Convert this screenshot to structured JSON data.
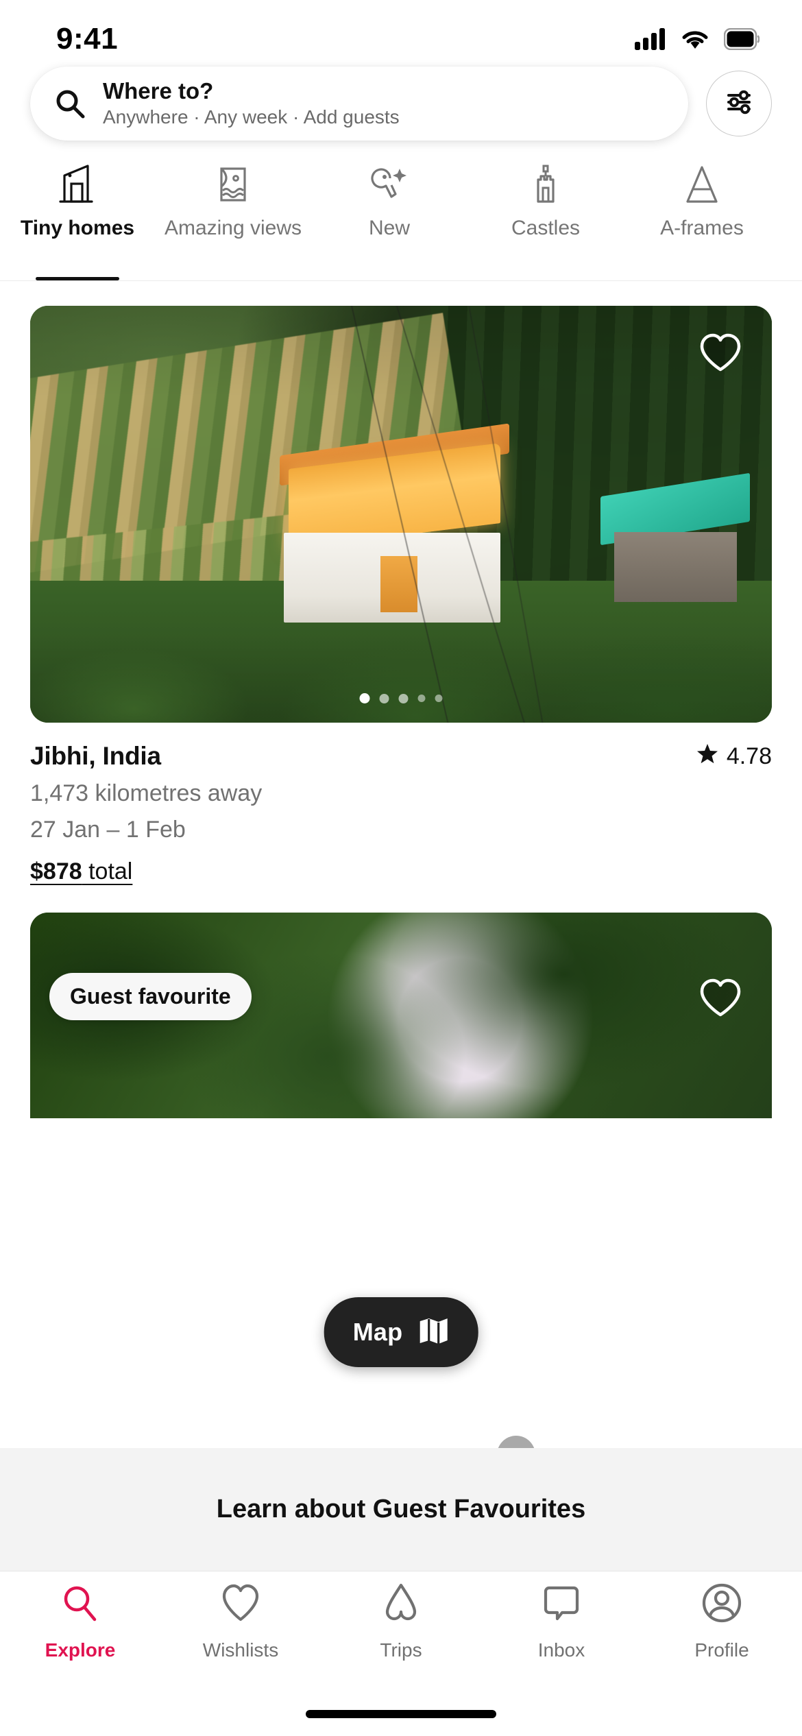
{
  "status_bar": {
    "time": "9:41",
    "icons": [
      "cellular-signal-icon",
      "wifi-icon",
      "battery-icon"
    ]
  },
  "search": {
    "icon": "search-icon",
    "title": "Where to?",
    "subtitle": "Anywhere · Any week · Add guests",
    "placeholder": "Where to?",
    "filter_icon": "filter-sliders-icon"
  },
  "categories": [
    {
      "label": "Tiny homes",
      "icon": "tiny-home-icon",
      "active": true
    },
    {
      "label": "Amazing views",
      "icon": "amazing-views-icon",
      "active": false
    },
    {
      "label": "New",
      "icon": "new-sparkle-icon",
      "active": false
    },
    {
      "label": "Castles",
      "icon": "castle-icon",
      "active": false
    },
    {
      "label": "A-frames",
      "icon": "a-frame-icon",
      "active": false
    }
  ],
  "listing": {
    "place": "Jibhi, India",
    "rating": "4.78",
    "rating_icon": "star-icon",
    "distance": "1,473 kilometres away",
    "dates": "27 Jan – 1 Feb",
    "price_amount": "$878",
    "price_suffix": " total",
    "favourite_icon": "heart-outline-icon",
    "carousel_dots": 5,
    "carousel_active_index": 0
  },
  "listing2": {
    "badge": "Guest favourite",
    "favourite_icon": "heart-outline-icon"
  },
  "map_button": {
    "label": "Map",
    "icon": "map-folded-icon"
  },
  "learn_banner": {
    "text": "Learn about Guest Favourites"
  },
  "tabbar": [
    {
      "label": "Explore",
      "icon": "search-icon",
      "active": true
    },
    {
      "label": "Wishlists",
      "icon": "heart-icon",
      "active": false
    },
    {
      "label": "Trips",
      "icon": "airbnb-icon",
      "active": false
    },
    {
      "label": "Inbox",
      "icon": "message-icon",
      "active": false
    },
    {
      "label": "Profile",
      "icon": "person-icon",
      "active": false
    }
  ],
  "colors": {
    "accent": "#e01350",
    "text_primary": "#111111",
    "text_secondary": "#717171",
    "fab_bg": "#222222",
    "banner_bg": "#f3f3f3"
  }
}
